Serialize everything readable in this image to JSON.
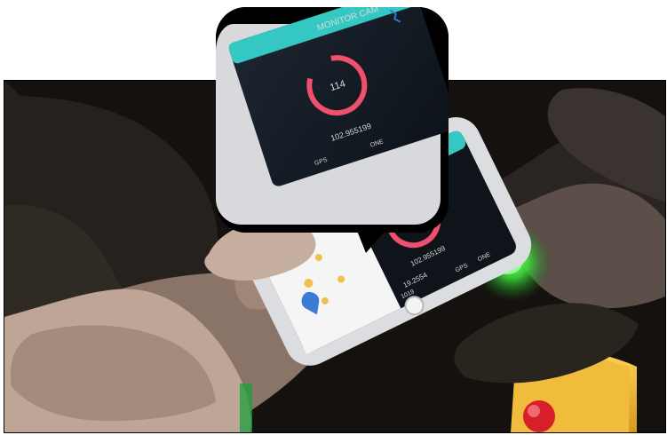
{
  "app": {
    "title": "MONITOR CAM",
    "heart_rate": "114",
    "coordinates": [
      "102.955199",
      "19.2554"
    ],
    "small_labels": [
      "GPS",
      "ONE",
      "1019"
    ]
  },
  "colors": {
    "accent_ring": "#f0506e",
    "header_bar": "#35c7c2",
    "green_led": "#4dfc4f",
    "red_button": "#d61f2b",
    "yellow_box": "#f3c33c"
  },
  "icons": {
    "bluetooth": "bluetooth-icon",
    "home": "home-button-icon"
  }
}
